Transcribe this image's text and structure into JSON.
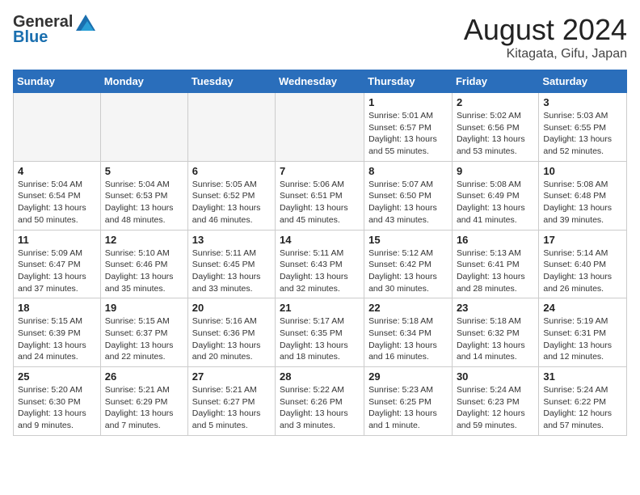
{
  "header": {
    "logo_general": "General",
    "logo_blue": "Blue",
    "month": "August 2024",
    "location": "Kitagata, Gifu, Japan"
  },
  "days_of_week": [
    "Sunday",
    "Monday",
    "Tuesday",
    "Wednesday",
    "Thursday",
    "Friday",
    "Saturday"
  ],
  "weeks": [
    [
      {
        "day": "",
        "info": ""
      },
      {
        "day": "",
        "info": ""
      },
      {
        "day": "",
        "info": ""
      },
      {
        "day": "",
        "info": ""
      },
      {
        "day": "1",
        "info": "Sunrise: 5:01 AM\nSunset: 6:57 PM\nDaylight: 13 hours\nand 55 minutes."
      },
      {
        "day": "2",
        "info": "Sunrise: 5:02 AM\nSunset: 6:56 PM\nDaylight: 13 hours\nand 53 minutes."
      },
      {
        "day": "3",
        "info": "Sunrise: 5:03 AM\nSunset: 6:55 PM\nDaylight: 13 hours\nand 52 minutes."
      }
    ],
    [
      {
        "day": "4",
        "info": "Sunrise: 5:04 AM\nSunset: 6:54 PM\nDaylight: 13 hours\nand 50 minutes."
      },
      {
        "day": "5",
        "info": "Sunrise: 5:04 AM\nSunset: 6:53 PM\nDaylight: 13 hours\nand 48 minutes."
      },
      {
        "day": "6",
        "info": "Sunrise: 5:05 AM\nSunset: 6:52 PM\nDaylight: 13 hours\nand 46 minutes."
      },
      {
        "day": "7",
        "info": "Sunrise: 5:06 AM\nSunset: 6:51 PM\nDaylight: 13 hours\nand 45 minutes."
      },
      {
        "day": "8",
        "info": "Sunrise: 5:07 AM\nSunset: 6:50 PM\nDaylight: 13 hours\nand 43 minutes."
      },
      {
        "day": "9",
        "info": "Sunrise: 5:08 AM\nSunset: 6:49 PM\nDaylight: 13 hours\nand 41 minutes."
      },
      {
        "day": "10",
        "info": "Sunrise: 5:08 AM\nSunset: 6:48 PM\nDaylight: 13 hours\nand 39 minutes."
      }
    ],
    [
      {
        "day": "11",
        "info": "Sunrise: 5:09 AM\nSunset: 6:47 PM\nDaylight: 13 hours\nand 37 minutes."
      },
      {
        "day": "12",
        "info": "Sunrise: 5:10 AM\nSunset: 6:46 PM\nDaylight: 13 hours\nand 35 minutes."
      },
      {
        "day": "13",
        "info": "Sunrise: 5:11 AM\nSunset: 6:45 PM\nDaylight: 13 hours\nand 33 minutes."
      },
      {
        "day": "14",
        "info": "Sunrise: 5:11 AM\nSunset: 6:43 PM\nDaylight: 13 hours\nand 32 minutes."
      },
      {
        "day": "15",
        "info": "Sunrise: 5:12 AM\nSunset: 6:42 PM\nDaylight: 13 hours\nand 30 minutes."
      },
      {
        "day": "16",
        "info": "Sunrise: 5:13 AM\nSunset: 6:41 PM\nDaylight: 13 hours\nand 28 minutes."
      },
      {
        "day": "17",
        "info": "Sunrise: 5:14 AM\nSunset: 6:40 PM\nDaylight: 13 hours\nand 26 minutes."
      }
    ],
    [
      {
        "day": "18",
        "info": "Sunrise: 5:15 AM\nSunset: 6:39 PM\nDaylight: 13 hours\nand 24 minutes."
      },
      {
        "day": "19",
        "info": "Sunrise: 5:15 AM\nSunset: 6:37 PM\nDaylight: 13 hours\nand 22 minutes."
      },
      {
        "day": "20",
        "info": "Sunrise: 5:16 AM\nSunset: 6:36 PM\nDaylight: 13 hours\nand 20 minutes."
      },
      {
        "day": "21",
        "info": "Sunrise: 5:17 AM\nSunset: 6:35 PM\nDaylight: 13 hours\nand 18 minutes."
      },
      {
        "day": "22",
        "info": "Sunrise: 5:18 AM\nSunset: 6:34 PM\nDaylight: 13 hours\nand 16 minutes."
      },
      {
        "day": "23",
        "info": "Sunrise: 5:18 AM\nSunset: 6:32 PM\nDaylight: 13 hours\nand 14 minutes."
      },
      {
        "day": "24",
        "info": "Sunrise: 5:19 AM\nSunset: 6:31 PM\nDaylight: 13 hours\nand 12 minutes."
      }
    ],
    [
      {
        "day": "25",
        "info": "Sunrise: 5:20 AM\nSunset: 6:30 PM\nDaylight: 13 hours\nand 9 minutes."
      },
      {
        "day": "26",
        "info": "Sunrise: 5:21 AM\nSunset: 6:29 PM\nDaylight: 13 hours\nand 7 minutes."
      },
      {
        "day": "27",
        "info": "Sunrise: 5:21 AM\nSunset: 6:27 PM\nDaylight: 13 hours\nand 5 minutes."
      },
      {
        "day": "28",
        "info": "Sunrise: 5:22 AM\nSunset: 6:26 PM\nDaylight: 13 hours\nand 3 minutes."
      },
      {
        "day": "29",
        "info": "Sunrise: 5:23 AM\nSunset: 6:25 PM\nDaylight: 13 hours\nand 1 minute."
      },
      {
        "day": "30",
        "info": "Sunrise: 5:24 AM\nSunset: 6:23 PM\nDaylight: 12 hours\nand 59 minutes."
      },
      {
        "day": "31",
        "info": "Sunrise: 5:24 AM\nSunset: 6:22 PM\nDaylight: 12 hours\nand 57 minutes."
      }
    ]
  ]
}
